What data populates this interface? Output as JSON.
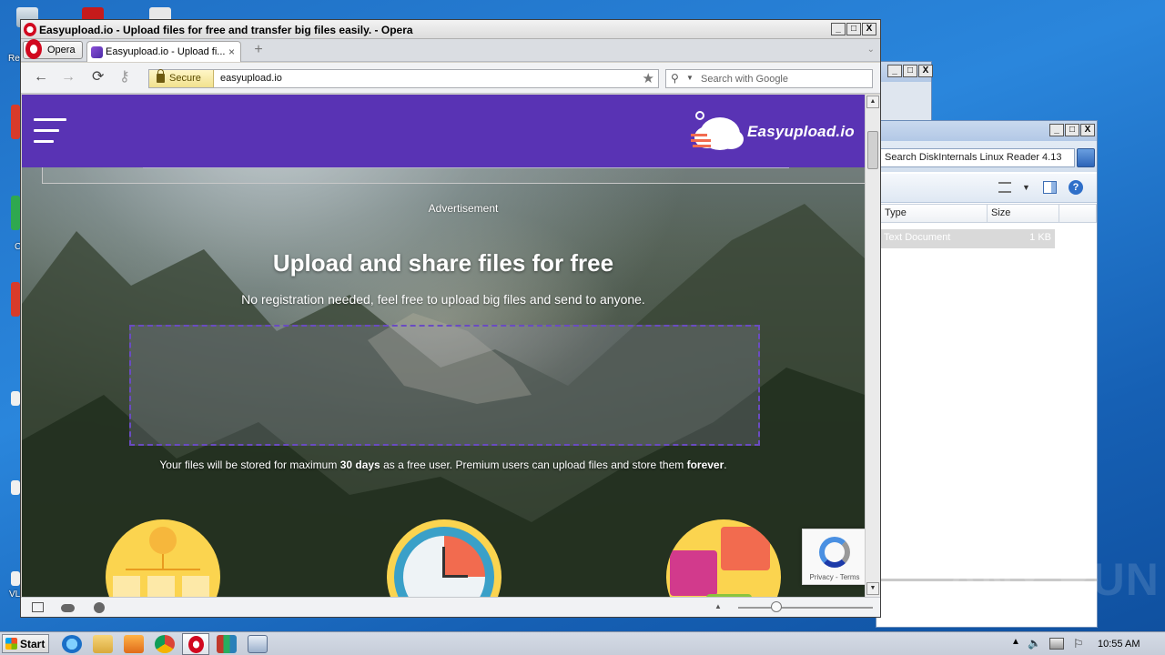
{
  "browser": {
    "window_title": "Easyupload.io - Upload files for free and transfer big files easily. - Opera",
    "menu_label": "Opera",
    "tab_title": "Easyupload.io - Upload fi...",
    "tab_close": "×",
    "new_tab": "+",
    "tab_overflow": "⌄",
    "secure_label": "Secure",
    "url": "easyupload.io",
    "search_placeholder": "Search with Google",
    "nav": {
      "back": "←",
      "forward": "→",
      "reload": "⟳",
      "key": "⚷"
    },
    "window_buttons": [
      "_",
      "□",
      "X"
    ]
  },
  "site": {
    "brand": "Easyupload.io",
    "advertisement": "Advertisement",
    "hero_title": "Upload and share files for free",
    "hero_subtitle": "No registration needed, feel free to upload big files and send to anyone.",
    "note_before_days": "Your files will be stored for maximum ",
    "note_days": "30 days",
    "note_middle": " as a free user. Premium users can upload files and store them ",
    "note_forever": "forever",
    "note_end": ".",
    "recaptcha_links": "Privacy - Terms"
  },
  "explorer": {
    "search_text": "Search DiskInternals Linux Reader 4.13",
    "columns": [
      "Type",
      "Size"
    ],
    "row": {
      "type": "Text Document",
      "size": "1 KB"
    }
  },
  "taskbar": {
    "start_label": "Start",
    "clock": "10:55 AM"
  },
  "desktop": {
    "labels": [
      "Re",
      "C",
      "VL"
    ]
  },
  "watermark": "ANY RUN",
  "colors": {
    "site_purple": "#5933b4",
    "opera_red": "#d1081f",
    "secure_yellow": "#f1e18d"
  }
}
